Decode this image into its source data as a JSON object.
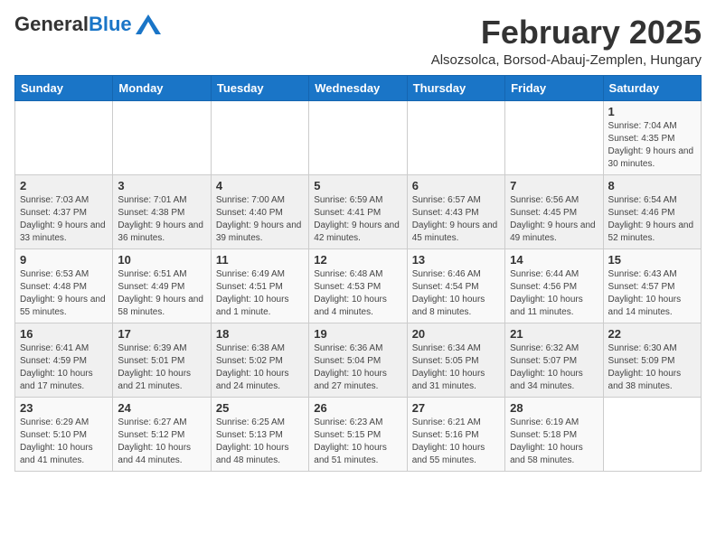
{
  "logo": {
    "general": "General",
    "blue": "Blue"
  },
  "title": {
    "month_year": "February 2025",
    "location": "Alsozsolca, Borsod-Abauj-Zemplen, Hungary"
  },
  "weekdays": [
    "Sunday",
    "Monday",
    "Tuesday",
    "Wednesday",
    "Thursday",
    "Friday",
    "Saturday"
  ],
  "weeks": [
    [
      {
        "day": "",
        "info": ""
      },
      {
        "day": "",
        "info": ""
      },
      {
        "day": "",
        "info": ""
      },
      {
        "day": "",
        "info": ""
      },
      {
        "day": "",
        "info": ""
      },
      {
        "day": "",
        "info": ""
      },
      {
        "day": "1",
        "info": "Sunrise: 7:04 AM\nSunset: 4:35 PM\nDaylight: 9 hours and 30 minutes."
      }
    ],
    [
      {
        "day": "2",
        "info": "Sunrise: 7:03 AM\nSunset: 4:37 PM\nDaylight: 9 hours and 33 minutes."
      },
      {
        "day": "3",
        "info": "Sunrise: 7:01 AM\nSunset: 4:38 PM\nDaylight: 9 hours and 36 minutes."
      },
      {
        "day": "4",
        "info": "Sunrise: 7:00 AM\nSunset: 4:40 PM\nDaylight: 9 hours and 39 minutes."
      },
      {
        "day": "5",
        "info": "Sunrise: 6:59 AM\nSunset: 4:41 PM\nDaylight: 9 hours and 42 minutes."
      },
      {
        "day": "6",
        "info": "Sunrise: 6:57 AM\nSunset: 4:43 PM\nDaylight: 9 hours and 45 minutes."
      },
      {
        "day": "7",
        "info": "Sunrise: 6:56 AM\nSunset: 4:45 PM\nDaylight: 9 hours and 49 minutes."
      },
      {
        "day": "8",
        "info": "Sunrise: 6:54 AM\nSunset: 4:46 PM\nDaylight: 9 hours and 52 minutes."
      }
    ],
    [
      {
        "day": "9",
        "info": "Sunrise: 6:53 AM\nSunset: 4:48 PM\nDaylight: 9 hours and 55 minutes."
      },
      {
        "day": "10",
        "info": "Sunrise: 6:51 AM\nSunset: 4:49 PM\nDaylight: 9 hours and 58 minutes."
      },
      {
        "day": "11",
        "info": "Sunrise: 6:49 AM\nSunset: 4:51 PM\nDaylight: 10 hours and 1 minute."
      },
      {
        "day": "12",
        "info": "Sunrise: 6:48 AM\nSunset: 4:53 PM\nDaylight: 10 hours and 4 minutes."
      },
      {
        "day": "13",
        "info": "Sunrise: 6:46 AM\nSunset: 4:54 PM\nDaylight: 10 hours and 8 minutes."
      },
      {
        "day": "14",
        "info": "Sunrise: 6:44 AM\nSunset: 4:56 PM\nDaylight: 10 hours and 11 minutes."
      },
      {
        "day": "15",
        "info": "Sunrise: 6:43 AM\nSunset: 4:57 PM\nDaylight: 10 hours and 14 minutes."
      }
    ],
    [
      {
        "day": "16",
        "info": "Sunrise: 6:41 AM\nSunset: 4:59 PM\nDaylight: 10 hours and 17 minutes."
      },
      {
        "day": "17",
        "info": "Sunrise: 6:39 AM\nSunset: 5:01 PM\nDaylight: 10 hours and 21 minutes."
      },
      {
        "day": "18",
        "info": "Sunrise: 6:38 AM\nSunset: 5:02 PM\nDaylight: 10 hours and 24 minutes."
      },
      {
        "day": "19",
        "info": "Sunrise: 6:36 AM\nSunset: 5:04 PM\nDaylight: 10 hours and 27 minutes."
      },
      {
        "day": "20",
        "info": "Sunrise: 6:34 AM\nSunset: 5:05 PM\nDaylight: 10 hours and 31 minutes."
      },
      {
        "day": "21",
        "info": "Sunrise: 6:32 AM\nSunset: 5:07 PM\nDaylight: 10 hours and 34 minutes."
      },
      {
        "day": "22",
        "info": "Sunrise: 6:30 AM\nSunset: 5:09 PM\nDaylight: 10 hours and 38 minutes."
      }
    ],
    [
      {
        "day": "23",
        "info": "Sunrise: 6:29 AM\nSunset: 5:10 PM\nDaylight: 10 hours and 41 minutes."
      },
      {
        "day": "24",
        "info": "Sunrise: 6:27 AM\nSunset: 5:12 PM\nDaylight: 10 hours and 44 minutes."
      },
      {
        "day": "25",
        "info": "Sunrise: 6:25 AM\nSunset: 5:13 PM\nDaylight: 10 hours and 48 minutes."
      },
      {
        "day": "26",
        "info": "Sunrise: 6:23 AM\nSunset: 5:15 PM\nDaylight: 10 hours and 51 minutes."
      },
      {
        "day": "27",
        "info": "Sunrise: 6:21 AM\nSunset: 5:16 PM\nDaylight: 10 hours and 55 minutes."
      },
      {
        "day": "28",
        "info": "Sunrise: 6:19 AM\nSunset: 5:18 PM\nDaylight: 10 hours and 58 minutes."
      },
      {
        "day": "",
        "info": ""
      }
    ]
  ]
}
